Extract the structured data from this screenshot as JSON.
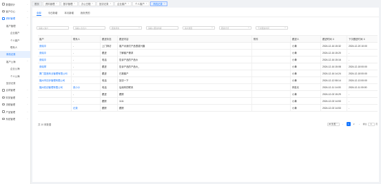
{
  "sidebar": {
    "items": [
      {
        "label": "数据统计",
        "level": 0,
        "arrow": "⌄",
        "state": ""
      },
      {
        "label": "客户中心",
        "level": 0,
        "arrow": "⌄",
        "state": ""
      },
      {
        "label": "资料管理",
        "level": 0,
        "arrow": "⌃",
        "state": "open"
      },
      {
        "label": "客户管理",
        "level": 1,
        "arrow": "⌃",
        "state": ""
      },
      {
        "label": "企业客户",
        "level": 2,
        "arrow": "",
        "state": ""
      },
      {
        "label": "个人客户",
        "level": 2,
        "arrow": "",
        "state": ""
      },
      {
        "label": "联系人",
        "level": 2,
        "arrow": "",
        "state": ""
      },
      {
        "label": "商机记录",
        "level": 1,
        "arrow": "",
        "state": "active"
      },
      {
        "label": "客户公海",
        "level": 1,
        "arrow": "⌃",
        "state": ""
      },
      {
        "label": "企业公海",
        "level": 2,
        "arrow": "",
        "state": ""
      },
      {
        "label": "个人公海",
        "level": 2,
        "arrow": "",
        "state": ""
      },
      {
        "label": "回访记录",
        "level": 1,
        "arrow": "",
        "state": ""
      },
      {
        "label": "合同管理",
        "level": 0,
        "arrow": "⌄",
        "state": ""
      },
      {
        "label": "财务管理",
        "level": 0,
        "arrow": "⌄",
        "state": ""
      },
      {
        "label": "流程管理",
        "level": 0,
        "arrow": "⌄",
        "state": ""
      },
      {
        "label": "产品管理",
        "level": 0,
        "arrow": "⌄",
        "state": ""
      },
      {
        "label": "系统管理",
        "level": 0,
        "arrow": "⌄",
        "state": ""
      }
    ]
  },
  "tabs": [
    {
      "label": "首页",
      "closable": false,
      "active": false,
      "home": true
    },
    {
      "label": "资料管理",
      "closable": true,
      "active": false,
      "home": false
    },
    {
      "label": "数字管理",
      "closable": true,
      "active": false,
      "home": false
    },
    {
      "label": "办公日程",
      "closable": true,
      "active": false,
      "home": false
    },
    {
      "label": "回访记录",
      "closable": true,
      "active": false,
      "home": false
    },
    {
      "label": "企业客户",
      "closable": true,
      "active": false,
      "home": false
    },
    {
      "label": "个人客户",
      "closable": true,
      "active": false,
      "home": false
    },
    {
      "label": "商机记录",
      "closable": true,
      "active": true,
      "home": false
    }
  ],
  "subtabs": [
    {
      "label": "全部",
      "active": true
    },
    {
      "label": "今日新增",
      "active": false
    },
    {
      "label": "本月新增",
      "active": false
    },
    {
      "label": "我负责的",
      "active": false
    }
  ],
  "filters": [
    {
      "placeholder": "请输入客户",
      "dropdown": false
    },
    {
      "placeholder": "请输入负责人",
      "dropdown": false
    },
    {
      "placeholder": "跟进状态",
      "dropdown": true
    },
    {
      "placeholder": "请输入跟进内容",
      "dropdown": false
    },
    {
      "placeholder": "客户类型",
      "dropdown": true
    },
    {
      "placeholder": "跟进方式",
      "dropdown": true
    },
    {
      "placeholder": "下次跟进时间",
      "dropdown": true
    }
  ],
  "table": {
    "headers": [
      "客户",
      "联系人",
      "跟进状态",
      "跟进内容",
      "附件",
      "跟进人",
      "跟进时间 ⇕",
      "下次跟进时间 ⇕"
    ],
    "rows": [
      [
        "张晓中",
        "-",
        "上门拜访",
        "客户对我们产品很感兴趣",
        "",
        "小黄",
        "2024-12-16 15:32",
        "2024-12-20 10:00"
      ],
      [
        "张晓中",
        "-",
        "跟进",
        "了解客户需求",
        "",
        "小黄",
        "2024-12-16 15:20",
        "-"
      ],
      [
        "张晓中",
        "-",
        "电话",
        "告诉产品的产品价",
        "",
        "小黄",
        "2024-12-16 15:16",
        "-"
      ],
      [
        "张晓琴",
        "-",
        "跟进",
        "告诉产品的产品价_",
        "",
        "小黄",
        "2024-12-16 15:08",
        "2024-12-18 00:00"
      ],
      [
        "厦门墨莲商业管理有限公司",
        "-",
        "跟进",
        "已报客户",
        "",
        "小黄",
        "2024-12-16 14:24",
        "2024-12-18 00:00"
      ],
      [
        "福州市初步管理有限公司",
        "-",
        "电话",
        "回访一下",
        "",
        "小黄",
        "2024-12-12 08:14",
        "2024-12-13 00:00"
      ],
      [
        "福州初创管理有限公司",
        "张小小",
        "电话",
        "后续有的联系",
        "",
        "林处长",
        "2024-12-11 14:03",
        "2024-12-11 00:00"
      ],
      [
        "",
        "-",
        "跟进",
        "跟踪",
        "",
        "小黄",
        "2024-12-02 15:29",
        "-"
      ],
      [
        "",
        "-",
        "跟踪",
        "1111",
        "",
        "小黄",
        "2024-12-02 14:53",
        "-"
      ],
      [
        "",
        "记录",
        "跟踪",
        "跟踪",
        "",
        "小黄",
        "2024-12-02 14:53",
        "-"
      ]
    ]
  },
  "pagination": {
    "total_label": "共 10 条数据",
    "page_size_label": "20 条/页",
    "prev": "‹",
    "pages": [
      "1",
      "2"
    ],
    "next": "›",
    "goto_label": "前往",
    "goto_value": "1",
    "page_suffix": "页"
  },
  "colors": {
    "accent": "#1677ff",
    "active_bg": "#e6f0ff"
  }
}
